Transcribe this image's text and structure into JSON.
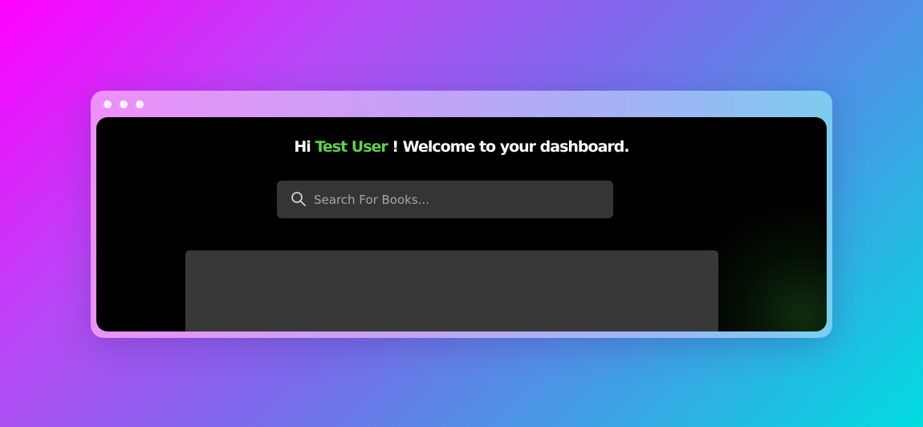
{
  "window": {
    "controls": [
      "dot",
      "dot",
      "dot"
    ]
  },
  "greeting": {
    "prefix": "Hi ",
    "user_name": "Test User",
    "suffix": " ! Welcome to your dashboard."
  },
  "search": {
    "icon": "search-icon",
    "placeholder": "Search For Books..."
  },
  "colors": {
    "accent_green": "#5ed14e",
    "screen_bg": "#000000",
    "surface": "#353535"
  }
}
